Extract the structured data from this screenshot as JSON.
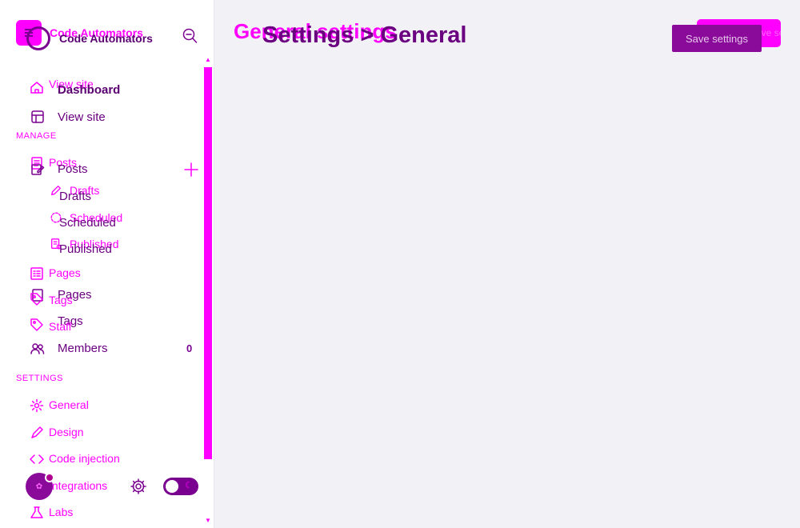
{
  "brand": {
    "ghost_name": "Code Automators",
    "name": "Code Automators"
  },
  "page": {
    "ghost_title": "General settings",
    "title": "Settings > General"
  },
  "actions": {
    "save_ghost": "Save settings",
    "save": "Save settings"
  },
  "sections": {
    "manage": "MANAGE",
    "settings": "SETTINGS"
  },
  "nav_ghost": {
    "view_site": "View site",
    "posts": "Posts",
    "drafts": "Drafts",
    "scheduled": "Scheduled",
    "published": "Published",
    "pages": "Pages",
    "tags": "Tags",
    "staff": "Staff",
    "general": "General",
    "design": "Design",
    "code_injection": "Code injection",
    "integrations": "Integrations",
    "labs": "Labs"
  },
  "nav": {
    "dashboard": "Dashboard",
    "view_site": "View site",
    "posts": "Posts",
    "drafts": "Drafts",
    "scheduled": "Scheduled",
    "published": "Published",
    "pages": "Pages",
    "tags": "Tags",
    "members": "Members",
    "members_count": "0"
  },
  "icons": {
    "ghost_logo": "menu-icon",
    "search": "search-icon",
    "add_post": "plus-icon",
    "settings": "gear-icon",
    "theme_toggle": "moon-icon"
  },
  "colors": {
    "accent": "#ff00ff",
    "primary": "#7a0090",
    "background": "#f2f2f6"
  }
}
